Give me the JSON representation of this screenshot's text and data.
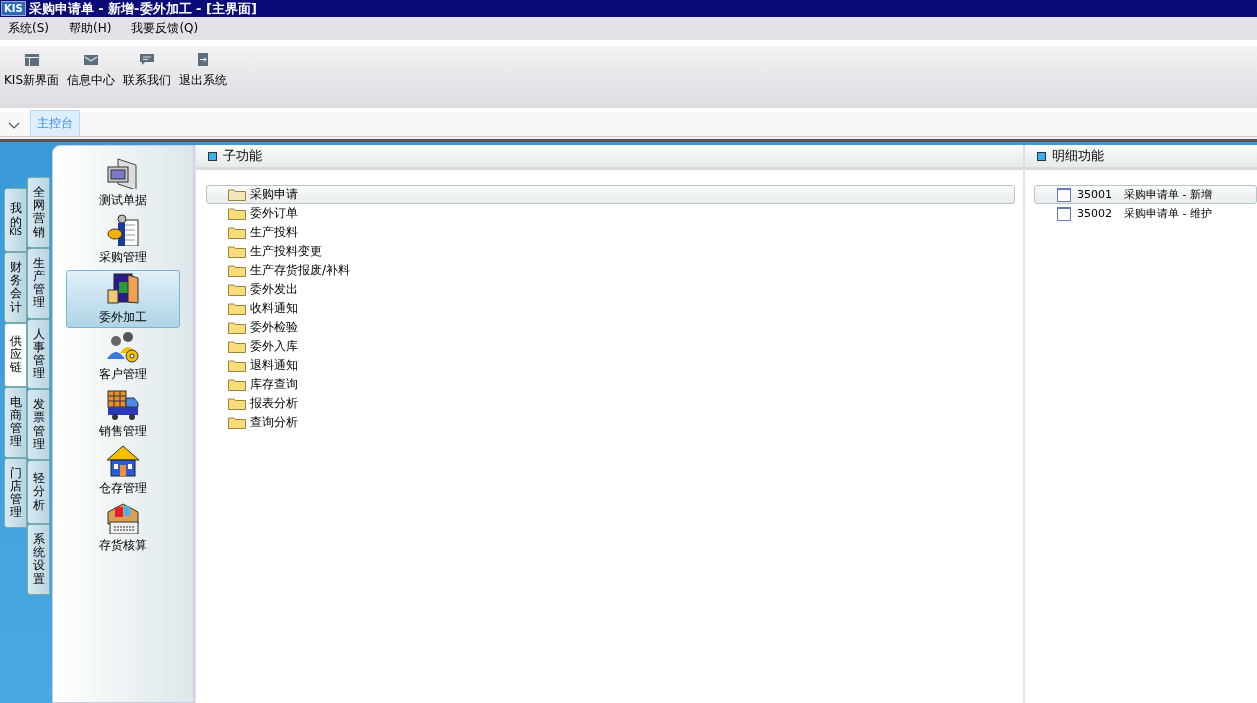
{
  "window": {
    "title": "采购申请单 - 新增-委外加工 - [主界面]",
    "logo": "KIS"
  },
  "menu": [
    {
      "label": "系统(S)"
    },
    {
      "label": "帮助(H)"
    },
    {
      "label": "我要反馈(Q)"
    }
  ],
  "toolbar": [
    {
      "label": "KIS新界面",
      "kind": "layout"
    },
    {
      "label": "信息中心",
      "kind": "mail"
    },
    {
      "label": "联系我们",
      "kind": "chat"
    },
    {
      "label": "退出系统",
      "kind": "exit"
    }
  ],
  "tabs": [
    {
      "label": "主控台",
      "selected": true
    }
  ],
  "side_tabs_outer": [
    {
      "label": "我的KIS",
      "selected": false
    },
    {
      "label": "财务会计",
      "selected": false
    },
    {
      "label": "供应链",
      "selected": true
    },
    {
      "label": "电商管理",
      "selected": false
    },
    {
      "label": "门店管理",
      "selected": false
    }
  ],
  "side_tabs_inner": [
    {
      "label": "全网营销",
      "selected": false
    },
    {
      "label": "生产管理",
      "selected": false
    },
    {
      "label": "人事管理",
      "selected": false
    },
    {
      "label": "发票管理",
      "selected": false
    },
    {
      "label": "轻分析",
      "selected": false
    },
    {
      "label": "系统设置",
      "selected": false
    }
  ],
  "modules": [
    {
      "label": "测试单据",
      "kind": "computer",
      "selected": false
    },
    {
      "label": "采购管理",
      "kind": "purchase",
      "selected": false
    },
    {
      "label": "委外加工",
      "kind": "door",
      "selected": true
    },
    {
      "label": "客户管理",
      "kind": "people",
      "selected": false
    },
    {
      "label": "销售管理",
      "kind": "truck",
      "selected": false
    },
    {
      "label": "仓存管理",
      "kind": "house",
      "selected": false
    },
    {
      "label": "存货核算",
      "kind": "register",
      "selected": false
    }
  ],
  "sub_functions": {
    "title": "子功能",
    "items": [
      {
        "label": "采购申请",
        "selected": true
      },
      {
        "label": "委外订单",
        "selected": false
      },
      {
        "label": "生产投料",
        "selected": false
      },
      {
        "label": "生产投料变更",
        "selected": false
      },
      {
        "label": "生产存货报废/补料",
        "selected": false
      },
      {
        "label": "委外发出",
        "selected": false
      },
      {
        "label": "收料通知",
        "selected": false
      },
      {
        "label": "委外检验",
        "selected": false
      },
      {
        "label": "委外入库",
        "selected": false
      },
      {
        "label": "退料通知",
        "selected": false
      },
      {
        "label": "库存查询",
        "selected": false
      },
      {
        "label": "报表分析",
        "selected": false
      },
      {
        "label": "查询分析",
        "selected": false
      }
    ]
  },
  "details": {
    "title": "明细功能",
    "items": [
      {
        "code": "35001",
        "label": "采购申请单 - 新增",
        "selected": true
      },
      {
        "code": "35002",
        "label": "采购申请单 - 维护",
        "selected": false
      }
    ]
  }
}
